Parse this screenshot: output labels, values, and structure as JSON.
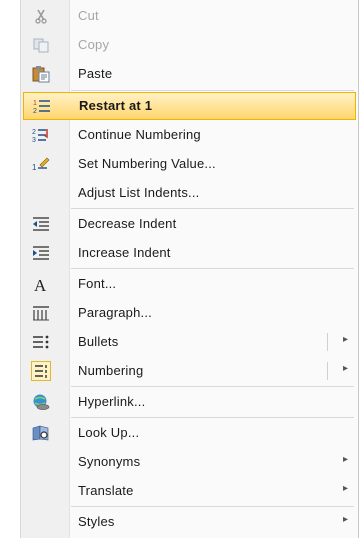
{
  "menu": {
    "cut": "Cut",
    "copy": "Copy",
    "paste": "Paste",
    "restart": "Restart at 1",
    "continue": "Continue Numbering",
    "set_value": "Set Numbering Value...",
    "adjust": "Adjust List Indents...",
    "decrease": "Decrease Indent",
    "increase": "Increase Indent",
    "font": "Font...",
    "paragraph": "Paragraph...",
    "bullets": "Bullets",
    "numbering": "Numbering",
    "hyperlink": "Hyperlink...",
    "lookup": "Look Up...",
    "synonyms": "Synonyms",
    "translate": "Translate",
    "styles": "Styles",
    "submenu_arrow": "▸"
  },
  "colors": {
    "hover_bg_top": "#fff1c6",
    "hover_bg_bottom": "#ffd76e",
    "hover_border": "#f2b400",
    "disabled_text": "#a6a6a6"
  },
  "icons": {
    "cut": "scissors-icon",
    "copy": "copy-icon",
    "paste": "paste-icon",
    "restart": "restart-numbering-icon",
    "continue": "continue-numbering-icon",
    "set_value": "set-numbering-value-icon",
    "decrease": "decrease-indent-icon",
    "increase": "increase-indent-icon",
    "font": "font-icon",
    "paragraph": "paragraph-icon",
    "bullets": "bullets-icon",
    "numbering": "numbering-icon",
    "hyperlink": "hyperlink-icon",
    "lookup": "research-icon"
  }
}
